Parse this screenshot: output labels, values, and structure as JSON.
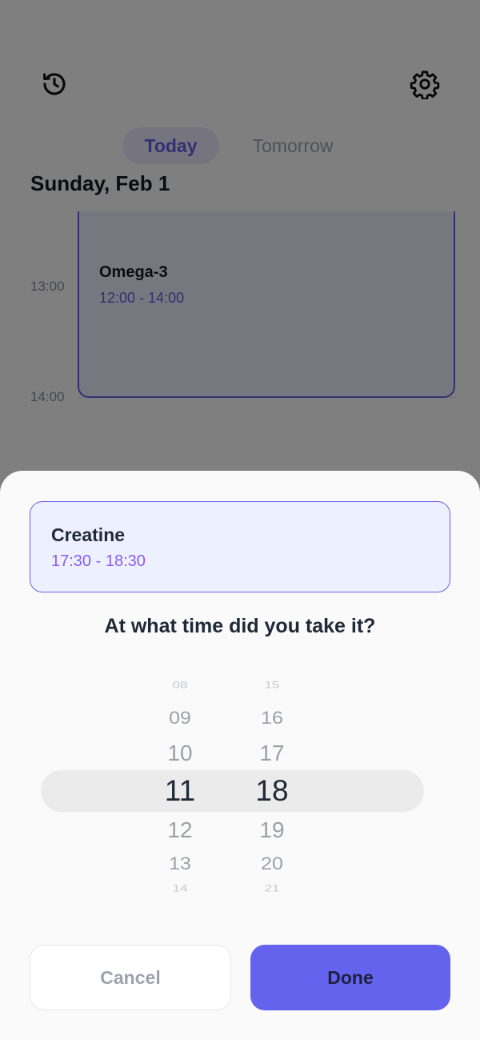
{
  "header": {
    "history_icon": "history-clock-icon",
    "settings_icon": "gear-icon"
  },
  "tabs": [
    {
      "label": "Today",
      "active": true
    },
    {
      "label": "Tomorrow",
      "active": false
    }
  ],
  "date_heading": "Sunday, Feb 1",
  "timeline": {
    "labels": [
      "13:00",
      "14:00"
    ],
    "event": {
      "title": "Omega-3",
      "time": "12:00 - 14:00"
    }
  },
  "sheet": {
    "selected": {
      "title": "Creatine",
      "time": "17:30 - 18:30"
    },
    "question": "At what time did you take it?",
    "hours": {
      "far_up": "08",
      "up2": "09",
      "up1": "10",
      "selected": "11",
      "dn1": "12",
      "dn2": "13",
      "far_down": "14"
    },
    "minutes": {
      "far_up": "15",
      "up2": "16",
      "up1": "17",
      "selected": "18",
      "dn1": "19",
      "dn2": "20",
      "far_down": "21"
    },
    "cancel_label": "Cancel",
    "done_label": "Done"
  },
  "colors": {
    "accent": "#6c5ce7",
    "done_button": "#6363ee",
    "event_time": "#7356e0"
  }
}
